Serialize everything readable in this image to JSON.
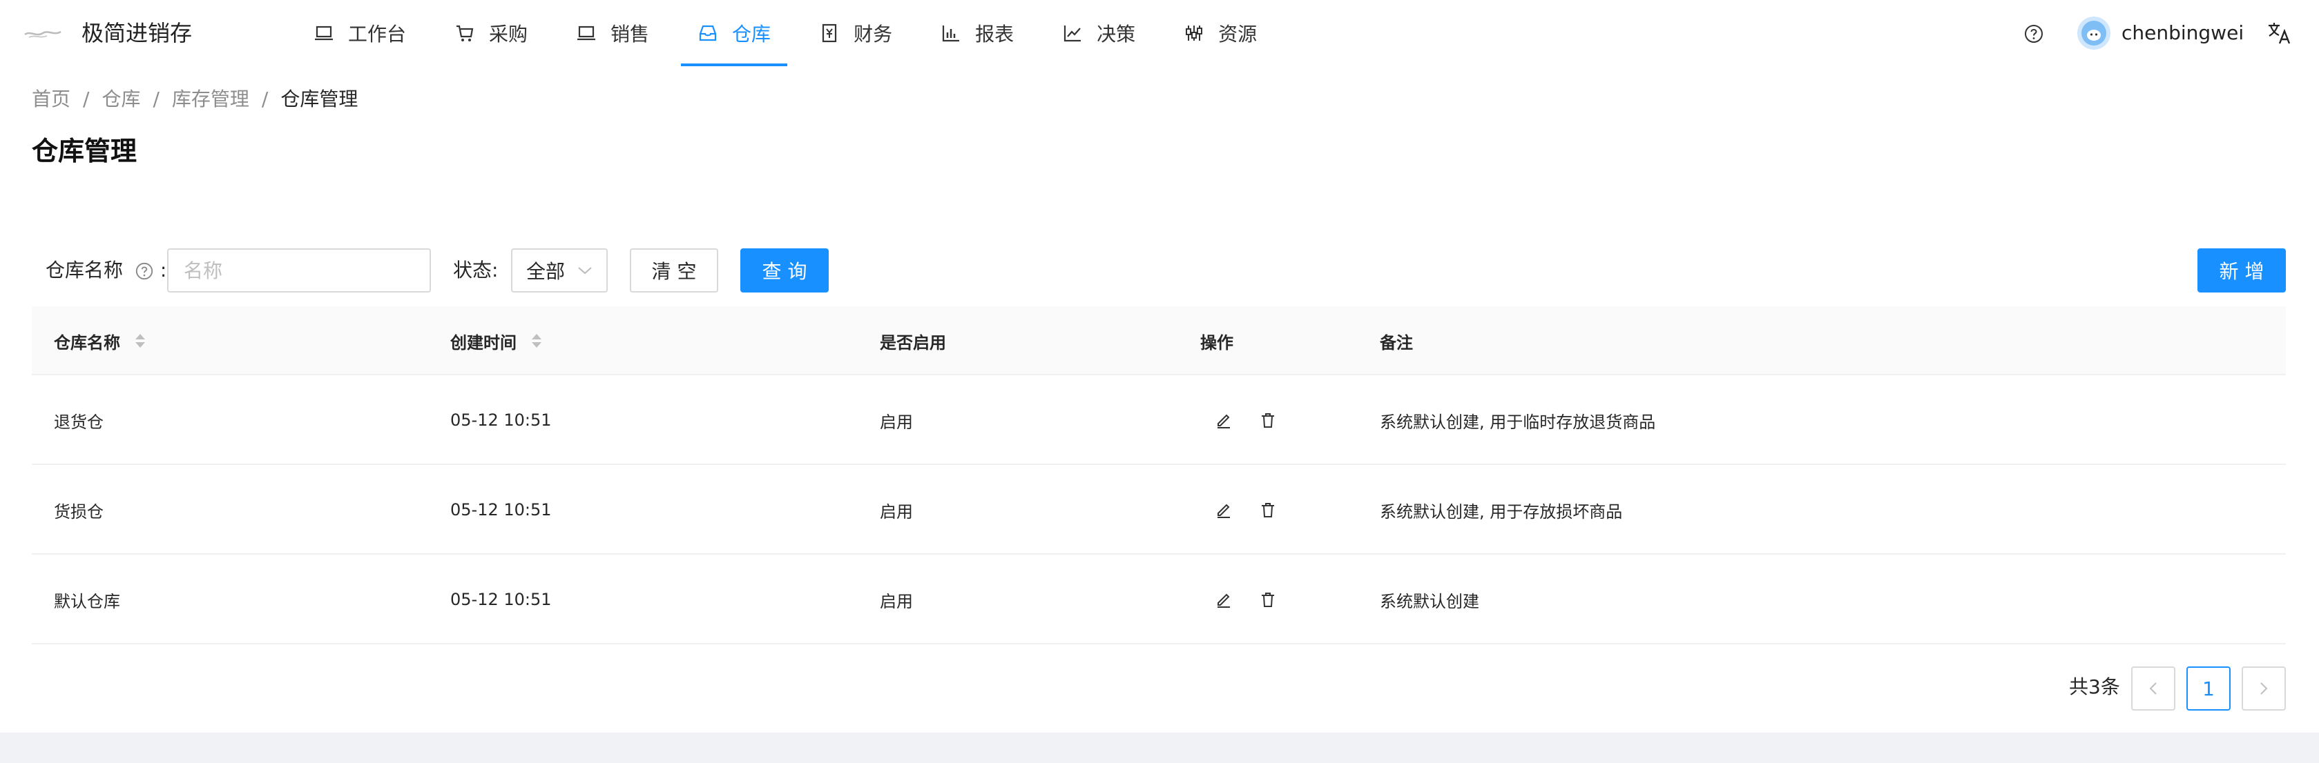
{
  "app": {
    "title": "极简进销存"
  },
  "nav": [
    {
      "label": "工作台",
      "icon": "laptop-icon"
    },
    {
      "label": "采购",
      "icon": "cart-icon"
    },
    {
      "label": "销售",
      "icon": "laptop-icon"
    },
    {
      "label": "仓库",
      "icon": "inbox-icon",
      "active": true
    },
    {
      "label": "财务",
      "icon": "account-book-icon"
    },
    {
      "label": "报表",
      "icon": "bar-chart-icon"
    },
    {
      "label": "决策",
      "icon": "line-chart-icon"
    },
    {
      "label": "资源",
      "icon": "sliders-icon"
    }
  ],
  "user": {
    "name": "chenbingwei"
  },
  "breadcrumb": [
    "首页",
    "仓库",
    "库存管理",
    "仓库管理"
  ],
  "breadcrumb_sep": "/",
  "page": {
    "title": "仓库管理"
  },
  "filters": {
    "name_label": "仓库名称",
    "name_colon": ":",
    "name_placeholder": "名称",
    "status_label": "状态:",
    "status_value": "全部"
  },
  "buttons": {
    "clear": "清 空",
    "query": "查 询",
    "add": "新 增"
  },
  "table": {
    "columns": [
      "仓库名称",
      "创建时间",
      "是否启用",
      "操作",
      "备注"
    ],
    "rows": [
      {
        "name": "退货仓",
        "created": "05-12 10:51",
        "enabled": "启用",
        "note": "系统默认创建, 用于临时存放退货商品"
      },
      {
        "name": "货损仓",
        "created": "05-12 10:51",
        "enabled": "启用",
        "note": "系统默认创建, 用于存放损坏商品"
      },
      {
        "name": "默认仓库",
        "created": "05-12 10:51",
        "enabled": "启用",
        "note": "系统默认创建"
      }
    ]
  },
  "pagination": {
    "total": "共3条",
    "current": "1"
  },
  "colors": {
    "primary": "#1890ff",
    "header_bg": "#fafafa",
    "border": "#f0f0f0"
  }
}
